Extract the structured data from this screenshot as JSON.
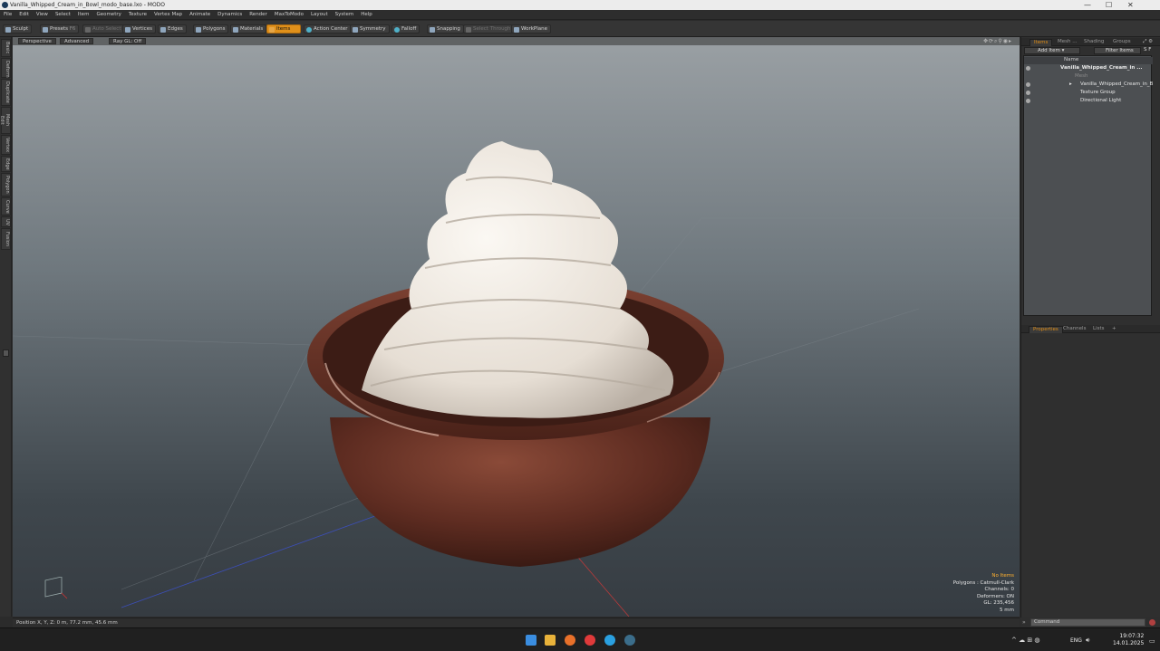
{
  "window": {
    "title": "Vanilla_Whipped_Cream_in_Bowl_modo_base.lxo - MODO",
    "controls": [
      "—",
      "☐",
      "✕"
    ]
  },
  "menu": [
    "File",
    "Edit",
    "View",
    "Select",
    "Item",
    "Geometry",
    "Texture",
    "Vertex Map",
    "Animate",
    "Dynamics",
    "Render",
    "MaxToModo",
    "Layout",
    "System",
    "Help"
  ],
  "toolbar": {
    "sculpt": "Sculpt",
    "presets": "Presets",
    "presets_key": "F6",
    "auto_select": "Auto Select",
    "vertices": "Vertices",
    "edges": "Edges",
    "polygons": "Polygons",
    "materials": "Materials",
    "items": "Items",
    "action_center": "Action Center",
    "symmetry": "Symmetry",
    "falloff": "Falloff",
    "snapping": "Snapping",
    "select_through": "Select Through",
    "workplane": "WorkPlane"
  },
  "left_tabs": [
    "Basic",
    "Deform",
    "Duplicate",
    "Mesh Edit",
    "Vertex",
    "Edge",
    "Polygon",
    "Curve",
    "UV",
    "Fusion"
  ],
  "viewport": {
    "view_mode": "Perspective",
    "shading": "Advanced",
    "ray_gl": "Ray GL: Off",
    "hud": {
      "status": "No Items",
      "polygons": "Polygons : Catmull-Clark",
      "channels": "Channels: 0",
      "deformers": "Deformers: ON",
      "gl": "GL: 235,456",
      "unit": "5 mm"
    }
  },
  "status": {
    "position": "Position X, Y, Z:  0 m, 77.2 mm, 45.6 mm"
  },
  "items_panel": {
    "tabs": [
      "Items",
      "Mesh ...",
      "Shading",
      "Groups"
    ],
    "add_item": "Add Item",
    "filter": "Filter Items",
    "column": "Name",
    "rows": [
      {
        "label": "Vanilla_Whipped_Cream_in ...",
        "indent": 1,
        "bold": true
      },
      {
        "label": "Mesh",
        "indent": 2,
        "dim": true
      },
      {
        "label": "Vanilla_Whipped_Cream_in_B",
        "indent": 2
      },
      {
        "label": "Texture Group",
        "indent": 2
      },
      {
        "label": "Directional Light",
        "indent": 2
      }
    ]
  },
  "props_panel": {
    "tabs": [
      "Properties",
      "Channels",
      "Lists",
      "+"
    ]
  },
  "command": {
    "placeholder": "Command"
  },
  "taskbar": {
    "lang": "ENG",
    "time": "19:07:32",
    "date": "14.01.2025"
  },
  "colors": {
    "accent": "#e0901a",
    "bowl": "#6b3326",
    "cream": "#efe9e1"
  }
}
